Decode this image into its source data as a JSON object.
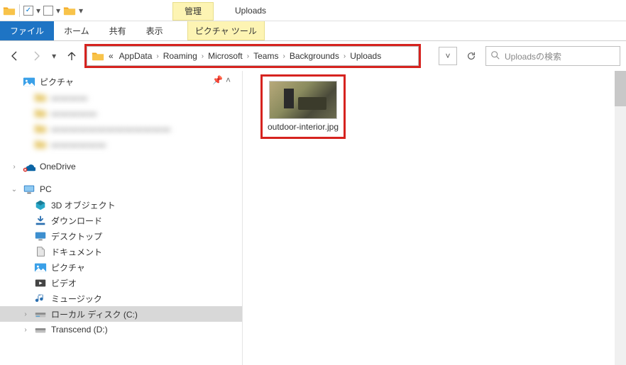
{
  "title": "Uploads",
  "ribbon": {
    "manage_label": "管理",
    "file": "ファイル",
    "home": "ホーム",
    "share": "共有",
    "view": "表示",
    "picture_tools": "ピクチャ ツール"
  },
  "breadcrumb": {
    "overflow": "«",
    "segments": [
      "AppData",
      "Roaming",
      "Microsoft",
      "Teams",
      "Backgrounds",
      "Uploads"
    ]
  },
  "search": {
    "placeholder": "Uploadsの検索"
  },
  "tree": {
    "pictures_root": "ピクチャ",
    "blurred": [
      "▬▬▬▬",
      "▬▬▬▬▬",
      "▬▬▬▬▬▬▬▬▬▬▬▬▬",
      "▬▬▬▬▬▬"
    ],
    "onedrive": "OneDrive",
    "pc": "PC",
    "pc_children": {
      "three_d": "3D オブジェクト",
      "downloads": "ダウンロード",
      "desktop": "デスクトップ",
      "documents": "ドキュメント",
      "pictures": "ピクチャ",
      "videos": "ビデオ",
      "music": "ミュージック",
      "local_disk": "ローカル ディスク (C:)",
      "transcend": "Transcend (D:)"
    }
  },
  "files": [
    {
      "name": "outdoor-interior.jpg"
    }
  ]
}
